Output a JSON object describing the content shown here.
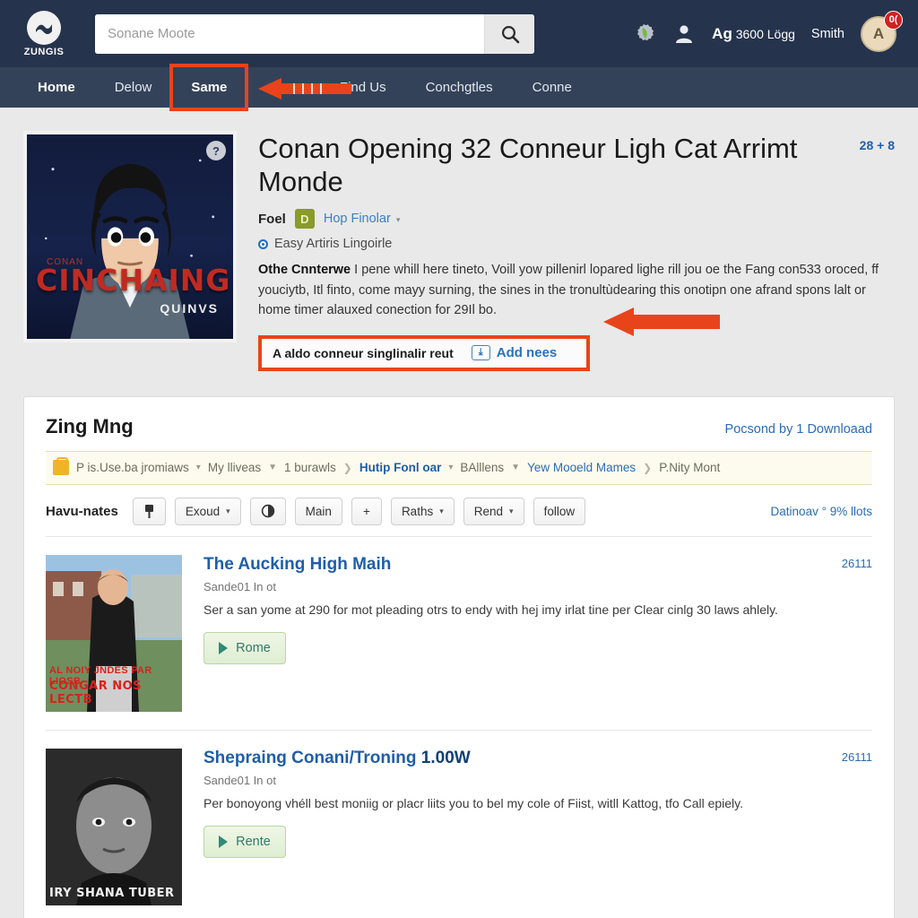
{
  "header": {
    "logo_text": "ZUNGIS",
    "logo_icon": "zungis-wave-logo",
    "search_placeholder": "Sonane Moote",
    "search_value": "",
    "search_icon": "search-icon",
    "gear_icon": "gear-leaf-icon",
    "person_icon": "person-icon",
    "points_prefix": "Ag",
    "points_value": "3600 Lögg",
    "username": "Smith",
    "avatar_initial": "A",
    "notification_badge": "0("
  },
  "nav": {
    "items": [
      {
        "label": "Home",
        "state": "home"
      },
      {
        "label": "Delow",
        "state": "normal"
      },
      {
        "label": "Same",
        "state": "boxed"
      },
      {
        "label": "Imme",
        "state": "faded"
      },
      {
        "label": "Find Us",
        "state": "normal"
      },
      {
        "label": "Conchgtles",
        "state": "normal"
      },
      {
        "label": "Conne",
        "state": "normal"
      }
    ]
  },
  "hero": {
    "poster": {
      "title": "CINCHAING",
      "supertitle": "CONAN",
      "subtitle": "QUINVS",
      "badge": "?"
    },
    "title": "Conan Opening 32 Conneur Ligh Cat Arrimt Monde",
    "count": "28 + 8",
    "meta_label": "Foel",
    "meta_badge": "D",
    "meta_link": "Hop Finolar",
    "sub_text": "Easy Artiris Lingoirle",
    "desc_lead": "Othe Cnnterwe",
    "desc_body": " I pene whill here tineto, Voill yow pillenirl lopared lighe rill jou oe the Fang con533 oroced, ff youciytb, Itl finto, come mayy surning, the sines in the tronultùdearing this onotipn one afrand spons lalt or home timer alauxed conection for 29Il bo.",
    "cta_text": "A aldo conneur singlinalir reut",
    "cta_link": "Add nees",
    "cta_icon": "download-box-icon"
  },
  "panel": {
    "title": "Zing Mng",
    "link": "Pocsond by 1 Downloaad",
    "breadcrumbs": [
      {
        "label": "P is.Use.ba jromiaws",
        "type": "plain",
        "caret": true
      },
      {
        "label": "My lliveas",
        "type": "plain",
        "caret": true
      },
      {
        "label": "1 burawls",
        "type": "plain",
        "caret": false,
        "sep": ">"
      },
      {
        "label": "Hutip Fonl oar",
        "type": "strong",
        "caret": true
      },
      {
        "label": "BAlllens",
        "type": "plain",
        "caret": true
      },
      {
        "label": "Yew Mooeld Mames",
        "type": "link",
        "caret": false,
        "sep": ">"
      },
      {
        "label": "P.Nity Mont",
        "type": "plain",
        "caret": false
      }
    ],
    "toolbar": {
      "label": "Havu-nates",
      "buttons": [
        {
          "label": "",
          "icon": "pin-icon",
          "caret": false
        },
        {
          "label": "Exoud",
          "icon": "",
          "caret": true
        },
        {
          "label": "",
          "icon": "contrast-icon",
          "caret": false
        },
        {
          "label": "Main",
          "icon": "",
          "caret": false
        },
        {
          "label": "+",
          "icon": "",
          "caret": false
        },
        {
          "label": "Raths",
          "icon": "",
          "caret": true
        },
        {
          "label": "Rend",
          "icon": "",
          "caret": true
        },
        {
          "label": "follow",
          "icon": "",
          "caret": false
        }
      ],
      "right_link": "Datinoav ° 9% llots"
    },
    "items": [
      {
        "title": "The Aucking High Maih",
        "title_suffix": "",
        "subtitle": "Sande01 In ot",
        "desc": "Ser a san yome at 290 for mot pleading otrs to endy with hej imy irlat tine per Clear cinlg 30 laws ahlely.",
        "button": "Rome",
        "count": "26111",
        "thumb_caption": "CONGAR NOS LECTB",
        "thumb_caption2": "AL NOIY JNDES PAR LIOSB",
        "thumb_style": "color"
      },
      {
        "title": "Shepraing Conani/Troning",
        "title_suffix": "1.00W",
        "subtitle": "Sande01 In ot",
        "desc": "Per bonoyong vhéll best moniig or placr liits you to bel my cole of Fiist, witll Kattog, tfo Call epiely.",
        "button": "Rente",
        "count": "26111",
        "thumb_caption": "IRY SHANA TUBER",
        "thumb_caption2": "",
        "thumb_style": "mono"
      }
    ]
  },
  "colors": {
    "topbar": "#26334d",
    "navbar": "#344259",
    "highlight": "#e8441c",
    "link": "#2a6cb5",
    "badge": "#d32020"
  }
}
